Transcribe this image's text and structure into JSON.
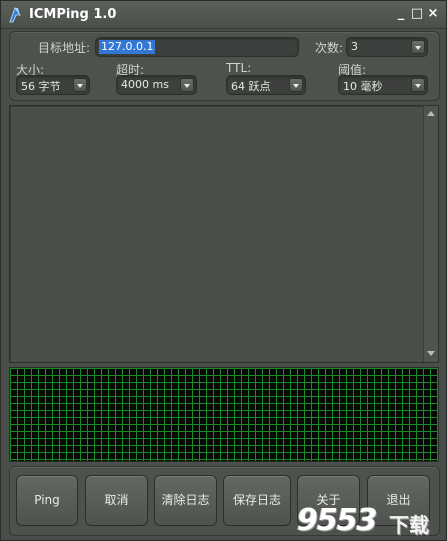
{
  "window": {
    "title": "ICMPing 1.0",
    "minimize": "_",
    "maximize": "□",
    "close": "×"
  },
  "settings": {
    "target_label": "目标地址:",
    "target_value": "127.0.0.1",
    "count_label": "次数:",
    "count_value": "3",
    "size_label": "大小:",
    "size_value": "56 字节",
    "timeout_label": "超时:",
    "timeout_value": "4000 ms",
    "ttl_label": "TTL:",
    "ttl_value": "64 跃点",
    "threshold_label": "阈值:",
    "threshold_value": "10 毫秒"
  },
  "buttons": {
    "ping": "Ping",
    "cancel": "取消",
    "clear_log": "清除日志",
    "save_log": "保存日志",
    "about": "关于",
    "exit": "退出"
  },
  "watermark": {
    "number": "9553",
    "text": "下载"
  },
  "colors": {
    "background": "#4a4e4a",
    "selection": "#3478d6",
    "graph_background": "#060906",
    "graph_grid": "#1c8a2a"
  },
  "icons": {
    "app": "ping-app-icon",
    "dropdown": "chevron-down-icon",
    "scroll_up": "arrow-up-icon",
    "scroll_down": "arrow-down-icon"
  }
}
